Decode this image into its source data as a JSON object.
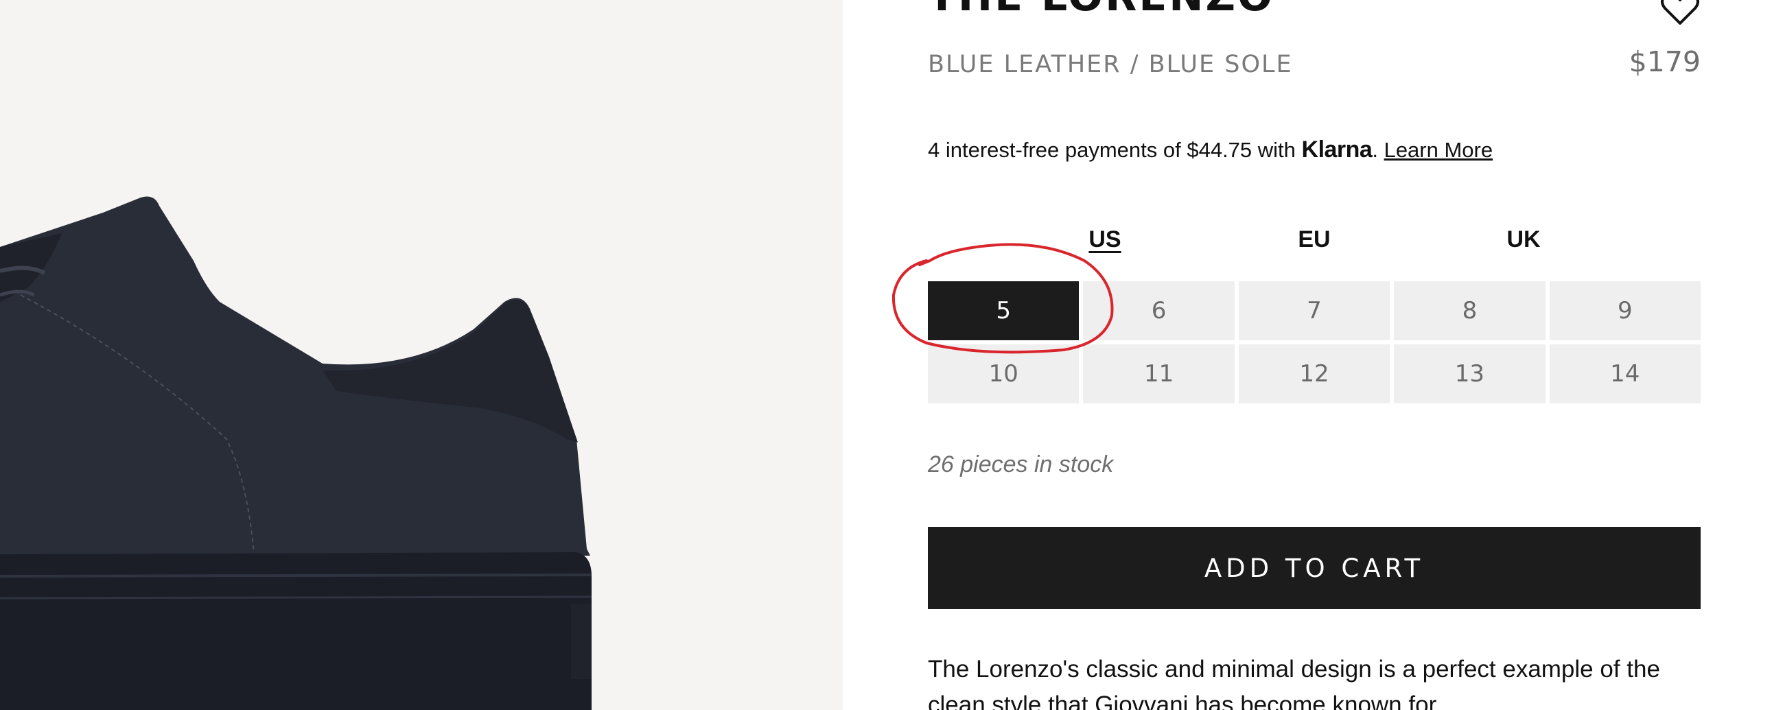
{
  "product": {
    "title": "THE LORENZO",
    "subtitle": "BLUE LEATHER / BLUE SOLE",
    "price": "$179",
    "wishlist_icon": "heart-outline-icon"
  },
  "payment": {
    "prefix": "4 interest-free payments of $44.75 with ",
    "brand": "Klarna",
    "suffix": ". ",
    "learn_more": "Learn More"
  },
  "sizing": {
    "systems": [
      {
        "label": "US",
        "active": true
      },
      {
        "label": "EU",
        "active": false
      },
      {
        "label": "UK",
        "active": false
      }
    ],
    "sizes": [
      "5",
      "6",
      "7",
      "8",
      "9",
      "10",
      "11",
      "12",
      "13",
      "14"
    ],
    "selected": "5"
  },
  "stock_text": "26 pieces in stock",
  "add_to_cart_label": "ADD TO CART",
  "description": "The Lorenzo's classic and minimal design is a perfect example of the clean style that Giovvani has become known for.",
  "colors": {
    "image_bg": "#f5f4f2",
    "shoe": "#262a35",
    "selected_bg": "#1c1c1c",
    "cell_bg": "#efefef",
    "annotation": "#d9262c"
  }
}
